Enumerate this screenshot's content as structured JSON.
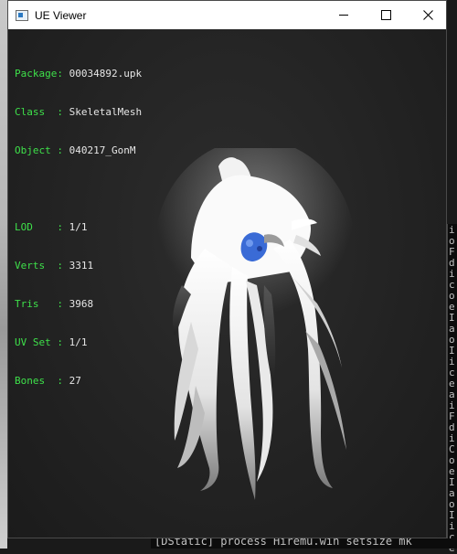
{
  "window": {
    "title": "UE Viewer"
  },
  "info": {
    "package_label": "Package: ",
    "package_value": "00034892.upk",
    "class_label": "Class  : ",
    "class_value": "SkeletalMesh",
    "object_label": "Object : ",
    "object_value": "040217_GonM",
    "lod_label": "LOD    : ",
    "lod_value": "1/1",
    "verts_label": "Verts  : ",
    "verts_value": "3311",
    "tris_label": "Tris   : ",
    "tris_value": "3968",
    "uvset_label": "UV Set : ",
    "uvset_value": "1/1",
    "bones_label": "Bones  : ",
    "bones_value": "27"
  },
  "console": {
    "bottom_text": "[DStatic] process  Hiremu.win setsize  mk",
    "right_chars": [
      "i",
      "o",
      "F",
      "d",
      "i",
      "c",
      "o",
      "e",
      "I",
      "a",
      "o",
      "I",
      "i",
      "c",
      "e",
      "a",
      "i",
      "F",
      "d",
      "i",
      "C",
      "o",
      "e",
      "I",
      "a",
      "o",
      "I",
      "i",
      "c",
      "e"
    ]
  },
  "colors": {
    "label": "#3ee04a",
    "value": "#e6e6e6",
    "viewport": "#232323",
    "hair_highlight": "#ffffff",
    "hair_accent": "#3a6bd6"
  },
  "icons": {
    "app": "app-window-icon",
    "minimize": "minimize-icon",
    "maximize": "maximize-icon",
    "close": "close-icon"
  }
}
